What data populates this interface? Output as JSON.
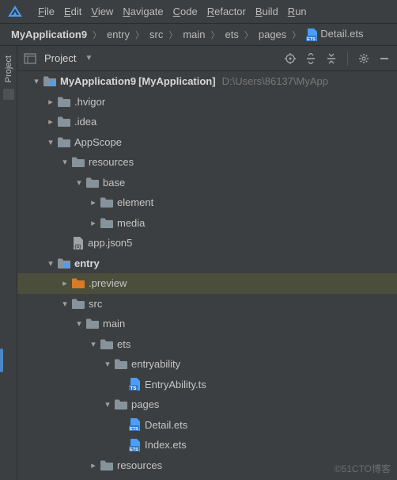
{
  "menu": [
    "File",
    "Edit",
    "View",
    "Navigate",
    "Code",
    "Refactor",
    "Build",
    "Run"
  ],
  "breadcrumbs": [
    "MyApplication9",
    "entry",
    "src",
    "main",
    "ets",
    "pages",
    "Detail.ets"
  ],
  "toolbar": {
    "project_label": "Project"
  },
  "sidebar": {
    "label": "Project"
  },
  "tree": [
    {
      "d": 0,
      "a": "expanded",
      "icon": "module",
      "label": "MyApplication9",
      "bold": true,
      "bracket": "[MyApplication]",
      "dim": "D:\\Users\\86137\\MyApp"
    },
    {
      "d": 1,
      "a": "collapsed",
      "icon": "folder",
      "label": ".hvigor"
    },
    {
      "d": 1,
      "a": "collapsed",
      "icon": "folder",
      "label": ".idea"
    },
    {
      "d": 1,
      "a": "expanded",
      "icon": "folder",
      "label": "AppScope"
    },
    {
      "d": 2,
      "a": "expanded",
      "icon": "folder",
      "label": "resources"
    },
    {
      "d": 3,
      "a": "expanded",
      "icon": "folder",
      "label": "base"
    },
    {
      "d": 4,
      "a": "collapsed",
      "icon": "folder",
      "label": "element"
    },
    {
      "d": 4,
      "a": "collapsed",
      "icon": "folder",
      "label": "media"
    },
    {
      "d": 2,
      "a": "none",
      "icon": "json5",
      "label": "app.json5"
    },
    {
      "d": 1,
      "a": "expanded",
      "icon": "module",
      "label": "entry",
      "bold": true
    },
    {
      "d": 2,
      "a": "collapsed",
      "icon": "folder-orange",
      "label": ".preview",
      "selected": true
    },
    {
      "d": 2,
      "a": "expanded",
      "icon": "folder",
      "label": "src"
    },
    {
      "d": 3,
      "a": "expanded",
      "icon": "folder",
      "label": "main"
    },
    {
      "d": 4,
      "a": "expanded",
      "icon": "folder",
      "label": "ets"
    },
    {
      "d": 5,
      "a": "expanded",
      "icon": "folder",
      "label": "entryability"
    },
    {
      "d": 6,
      "a": "none",
      "icon": "ts",
      "label": "EntryAbility.ts"
    },
    {
      "d": 5,
      "a": "expanded",
      "icon": "folder",
      "label": "pages"
    },
    {
      "d": 6,
      "a": "none",
      "icon": "ets",
      "label": "Detail.ets"
    },
    {
      "d": 6,
      "a": "none",
      "icon": "ets",
      "label": "Index.ets"
    },
    {
      "d": 4,
      "a": "collapsed",
      "icon": "folder",
      "label": "resources"
    }
  ],
  "watermark": "©51CTO博客"
}
